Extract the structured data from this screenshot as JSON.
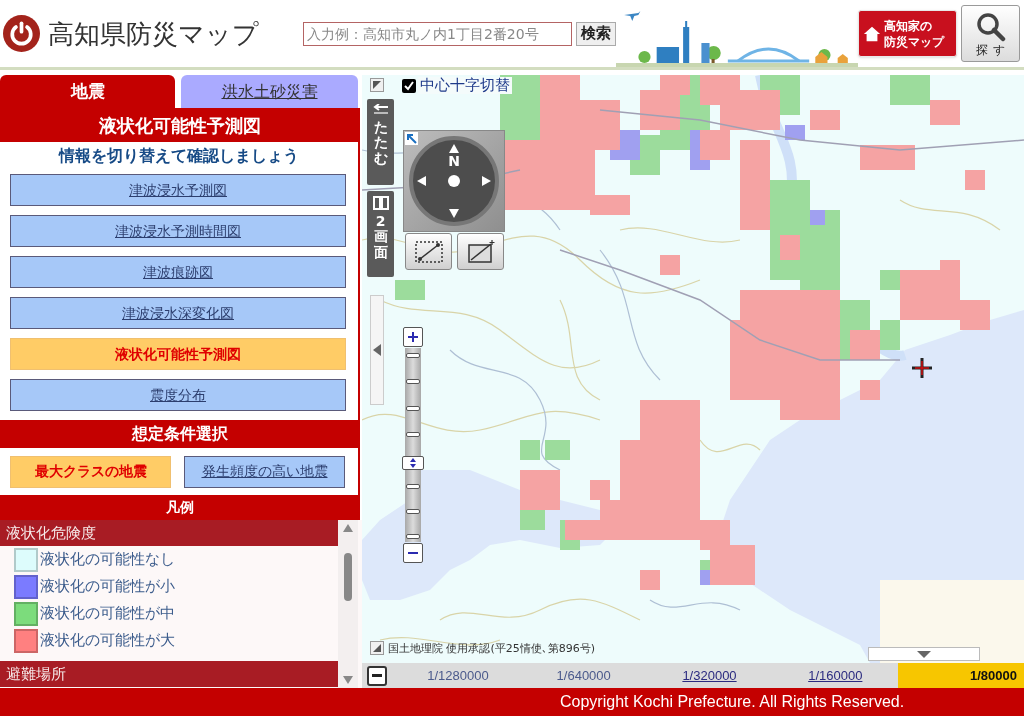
{
  "header": {
    "title": "高知県防災マップ",
    "search": {
      "placeholder": "入力例：高知市丸ノ内1丁目2番20号",
      "button": "検索"
    },
    "portal_button": {
      "lines": [
        "高知家の",
        "防災マップ"
      ]
    },
    "find_button": "探す"
  },
  "sidebar": {
    "tabs": [
      {
        "label": "地震",
        "selected": true
      },
      {
        "label": "洪水土砂災害",
        "selected": false
      }
    ],
    "heading": "液状化可能性予測図",
    "subheading": "情報を切り替えて確認しましょう",
    "map_buttons": [
      {
        "label": "津波浸水予測図",
        "selected": false
      },
      {
        "label": "津波浸水予測時間図",
        "selected": false
      },
      {
        "label": "津波痕跡図",
        "selected": false
      },
      {
        "label": "津波浸水深変化図",
        "selected": false
      },
      {
        "label": "液状化可能性予測図",
        "selected": true
      },
      {
        "label": "震度分布",
        "selected": false
      }
    ],
    "conditions": {
      "title": "想定条件選択",
      "options": [
        {
          "label": "最大クラスの地震",
          "selected": true
        },
        {
          "label": "発生頻度の高い地震",
          "selected": false
        }
      ]
    },
    "legend": {
      "title": "凡例",
      "groups": [
        {
          "title": "液状化危険度",
          "items": [
            {
              "label": "液状化の可能性なし",
              "color": "#ddfcfc"
            },
            {
              "label": "液状化の可能性が小",
              "color": "#7b7bff"
            },
            {
              "label": "液状化の可能性が中",
              "color": "#7cdc7c"
            },
            {
              "label": "液状化の可能性が大",
              "color": "#ff8080"
            }
          ]
        },
        {
          "title": "避難場所"
        }
      ]
    }
  },
  "map": {
    "center_cross": {
      "label": "中心十字切替",
      "checked": true
    },
    "collapse_button": "たたむ",
    "split_button": "2画面",
    "compass_label": "N",
    "zoom": {
      "level": 0.4
    },
    "attribution": "国土地理院 使用承認(平25情使､第896号)"
  },
  "scale_bar": [
    {
      "label": "1/1280000",
      "selected": false,
      "disabled": true
    },
    {
      "label": "1/640000",
      "selected": false,
      "disabled": true
    },
    {
      "label": "1/320000",
      "selected": false,
      "disabled": false
    },
    {
      "label": "1/160000",
      "selected": false,
      "disabled": false
    },
    {
      "label": "1/80000",
      "selected": true,
      "disabled": false
    }
  ],
  "footer": "Copyright Kochi Prefecture. All Rights Reserved."
}
